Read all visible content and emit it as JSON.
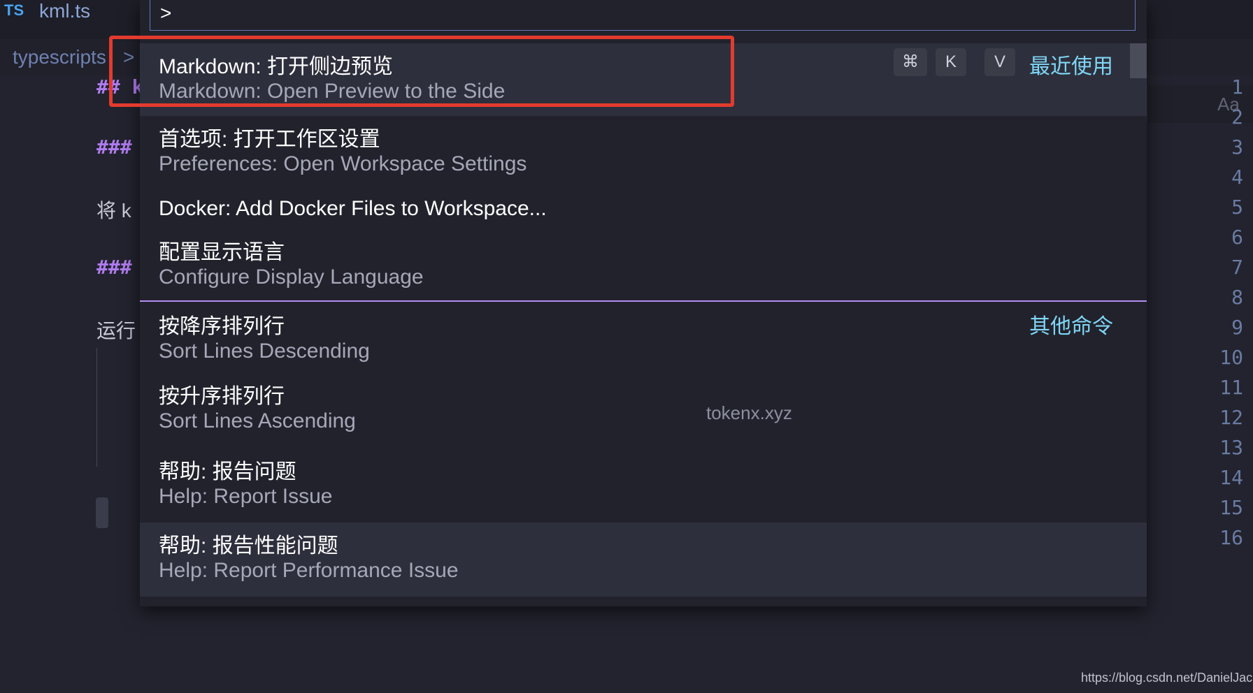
{
  "editor": {
    "tab": {
      "lang_badge": "TS",
      "filename": "kml.ts"
    },
    "breadcrumb": {
      "folder": "typescripts",
      "separator": ">"
    },
    "find_widget": {
      "match_case_label": "Aa"
    },
    "line_numbers": [
      "1",
      "2",
      "3",
      "4",
      "5",
      "6",
      "7",
      "8",
      "9",
      "10",
      "11",
      "12",
      "13",
      "14",
      "15",
      "16"
    ],
    "code_fragments": {
      "line1": "## k",
      "line3": "###",
      "line5": "将 k",
      "line7": "###",
      "line9": "运行"
    }
  },
  "palette": {
    "input_value": ">",
    "items": [
      {
        "label": "Markdown: 打开侧边预览",
        "desc": "Markdown: Open Preview to the Side",
        "keys": [
          "⌘",
          "K",
          "V"
        ],
        "category": "最近使用"
      },
      {
        "label": "首选项: 打开工作区设置",
        "desc": "Preferences: Open Workspace Settings"
      },
      {
        "label": "Docker: Add Docker Files to Workspace..."
      },
      {
        "label": "配置显示语言",
        "desc": "Configure Display Language"
      },
      {
        "label": "按降序排列行",
        "desc": "Sort Lines Descending",
        "category": "其他命令"
      },
      {
        "label": "按升序排列行",
        "desc": "Sort Lines Ascending"
      },
      {
        "label": "帮助: 报告问题",
        "desc": "Help: Report Issue"
      },
      {
        "label": "帮助: 报告性能问题",
        "desc": "Help: Report Performance Issue"
      }
    ]
  },
  "watermark": "tokenx.xyz",
  "credit": "https://blog.csdn.net/DanielJackZ",
  "colors": {
    "accent_category": "#7fd6f5",
    "divider": "#b48ef2",
    "annotation_box": "#e33b2e",
    "heading_purple": "#b07cf0"
  }
}
